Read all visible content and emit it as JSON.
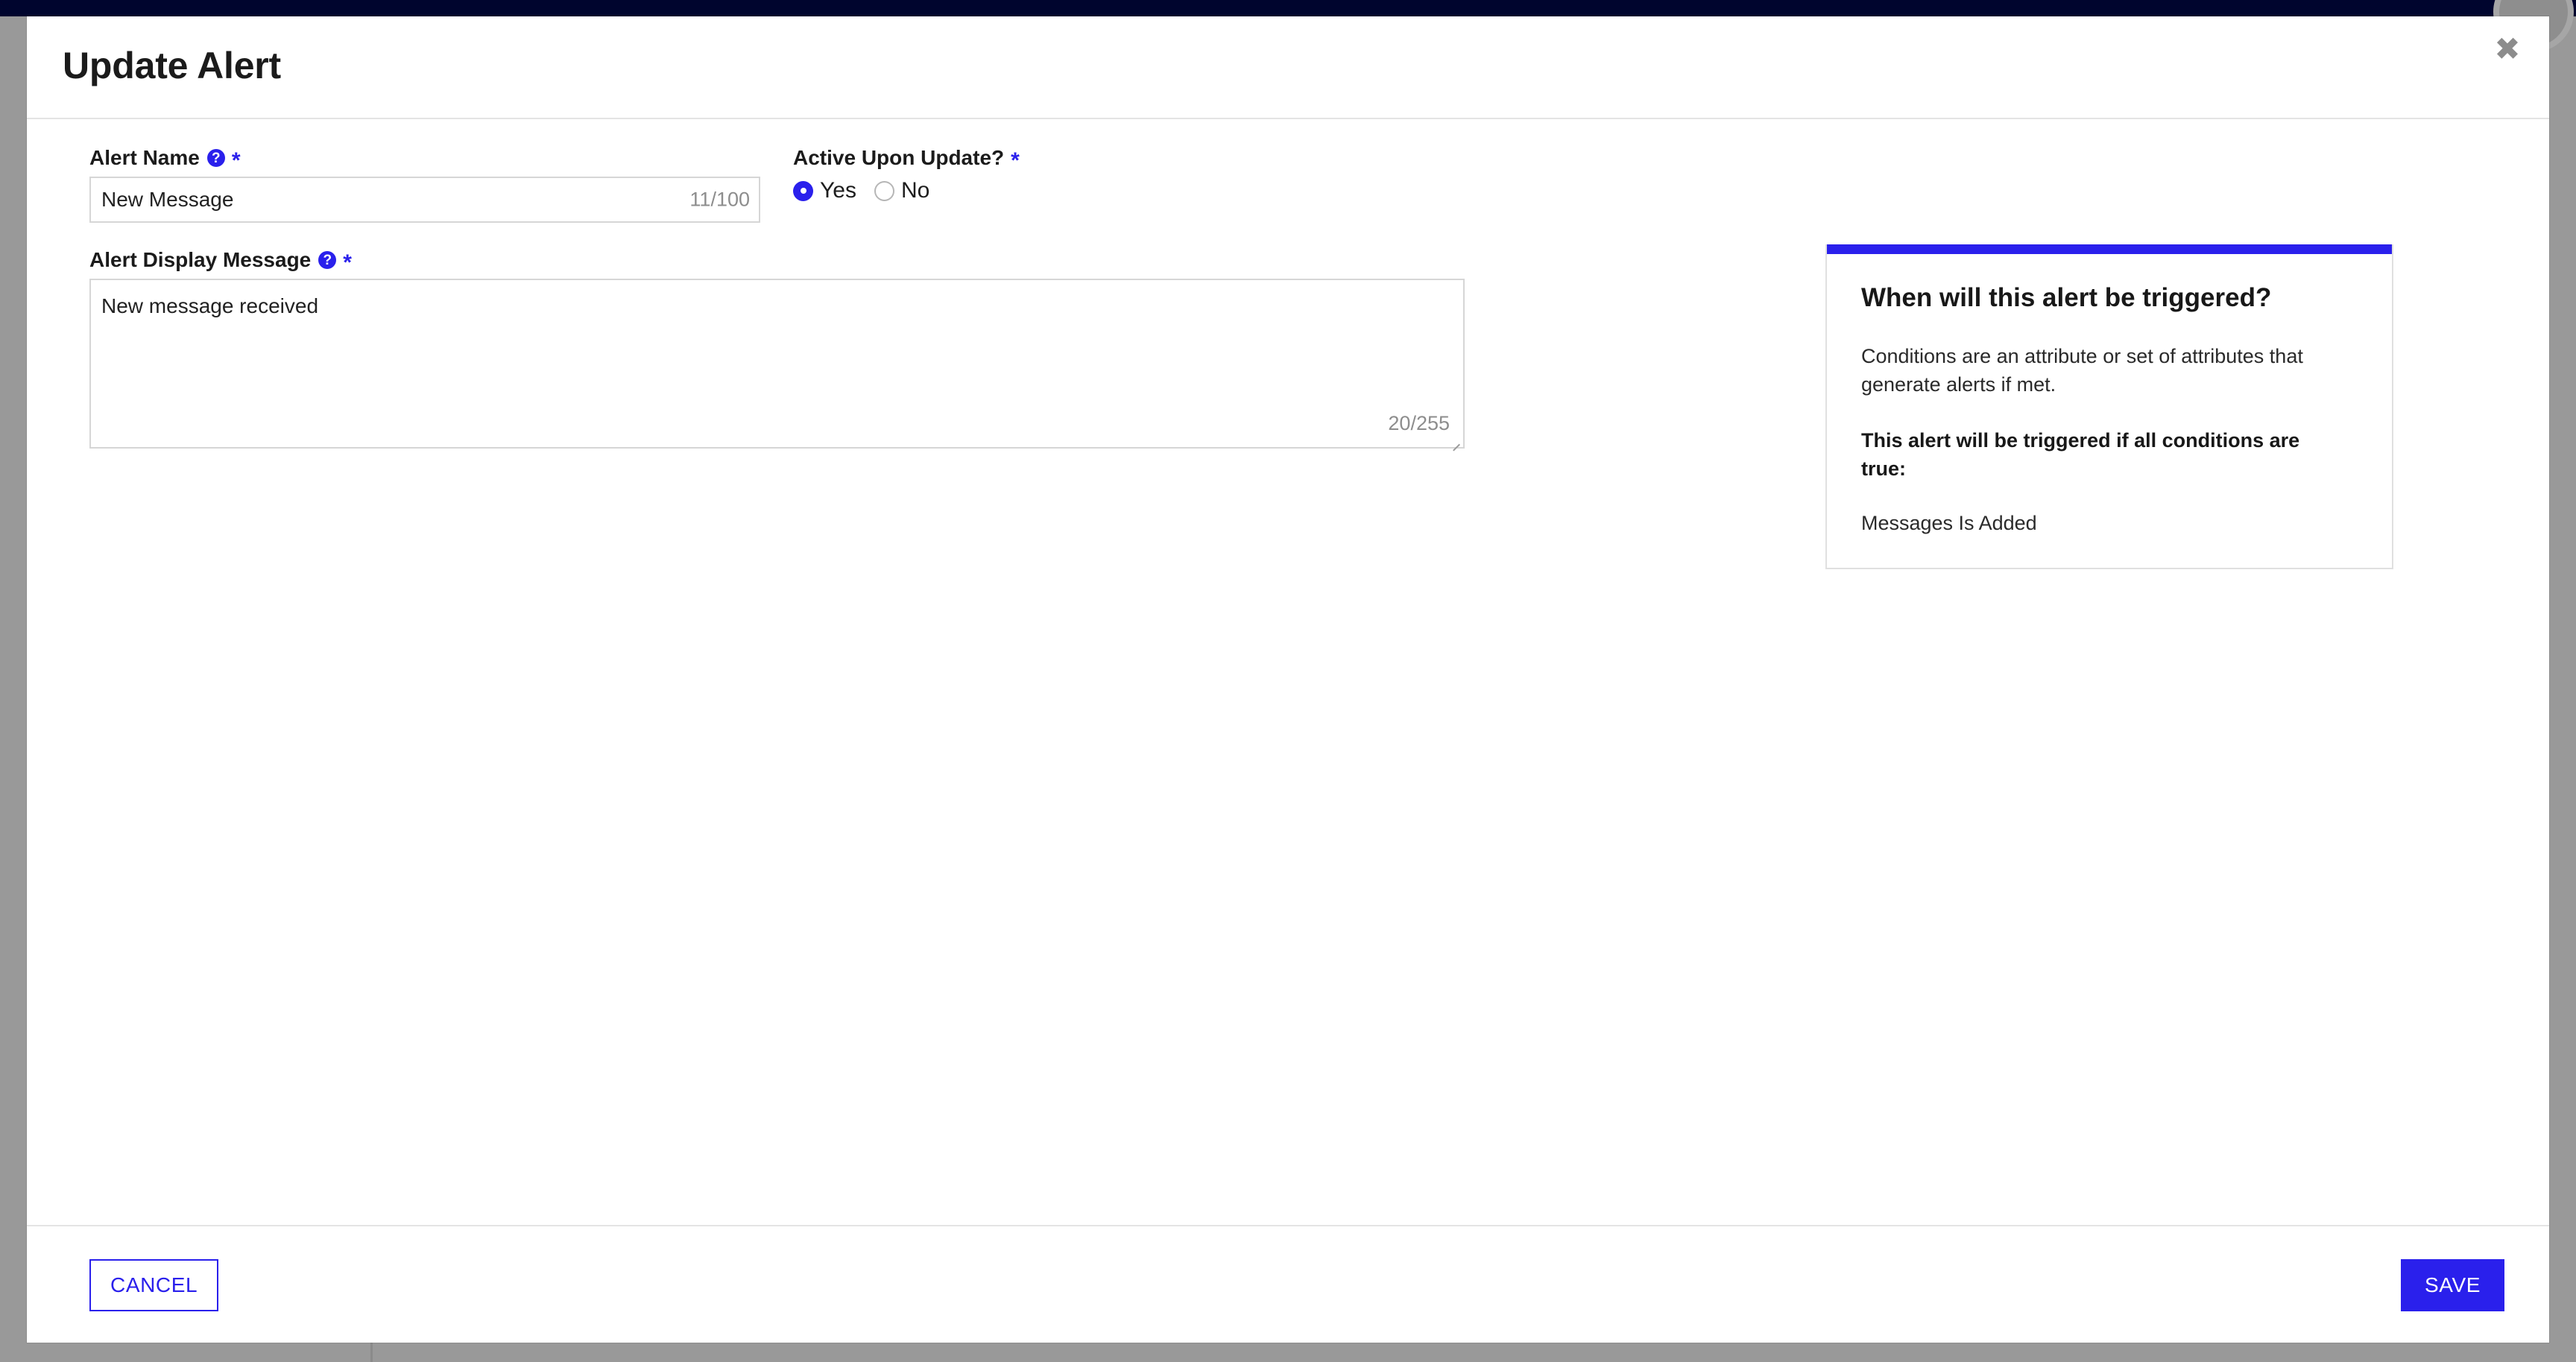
{
  "theme": {
    "accent": "#2a20ec",
    "topbar": "#00052e",
    "overlay": "#999999",
    "border": "#d6d6d6",
    "muted_text": "#8d8d8d"
  },
  "modal": {
    "title": "Update Alert",
    "close_icon": "close-icon"
  },
  "form": {
    "alert_name": {
      "label": "Alert Name",
      "help_icon": "?",
      "required_marker": "*",
      "value": "New Message",
      "placeholder": "Alert Name",
      "char_count": "11/100"
    },
    "alert_display_message": {
      "label": "Alert Display Message",
      "help_icon": "?",
      "required_marker": "*",
      "value": "New message received",
      "placeholder": "Alert Display Message",
      "char_count": "20/255"
    },
    "active_upon_update": {
      "label": "Active Upon Update?",
      "required_marker": "*",
      "selected": "Yes",
      "options": [
        {
          "label": "Yes",
          "checked": true
        },
        {
          "label": "No",
          "checked": false
        }
      ]
    }
  },
  "info_card": {
    "title": "When will this alert be triggered?",
    "paragraph": "Conditions are an attribute or set of attributes that generate alerts if met.",
    "bold_paragraph": "This alert will be triggered if all conditions are true:",
    "conditions": [
      "Messages Is Added"
    ]
  },
  "footer": {
    "cancel_label": "CANCEL",
    "save_label": "SAVE"
  }
}
